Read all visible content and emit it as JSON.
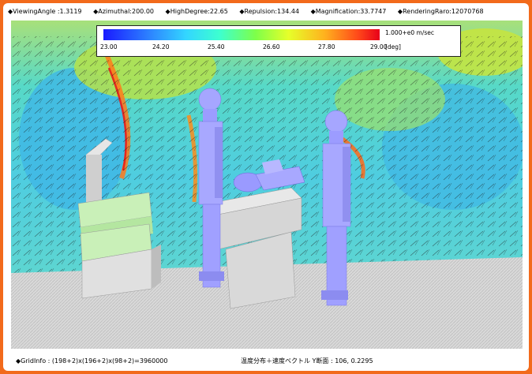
{
  "header": {
    "viewing_angle": "◆ViewingAngle :1.3119",
    "azimuthal": "◆Azimuthal:200.00",
    "high_degree": "◆HighDegree:22.65",
    "repulsion": "◆Repulsion:134.44",
    "magnification": "◆Magnification:33.7747",
    "rendering_ratio": "◆RenderingRaro:12070768"
  },
  "legend": {
    "ticks": [
      "23.00",
      "24.20",
      "25.40",
      "26.60",
      "27.80",
      "29.00"
    ],
    "velocity_label": "1.000+e0 m/sec",
    "unit_label": "[deg]",
    "colors": [
      "#1a1aff",
      "#33d6ff",
      "#7dff4a",
      "#ffb21e",
      "#e8001a"
    ]
  },
  "footer": {
    "grid_info": "◆GridInfo : (198+2)x(196+2)x(98+2)=3960000",
    "section_info": "温度分布＋速度ベクトル Y断面 : 106, 0.2295"
  },
  "scene": {
    "objects": [
      "bed-cart",
      "operating-table",
      "patient",
      "person-left",
      "person-right"
    ]
  }
}
